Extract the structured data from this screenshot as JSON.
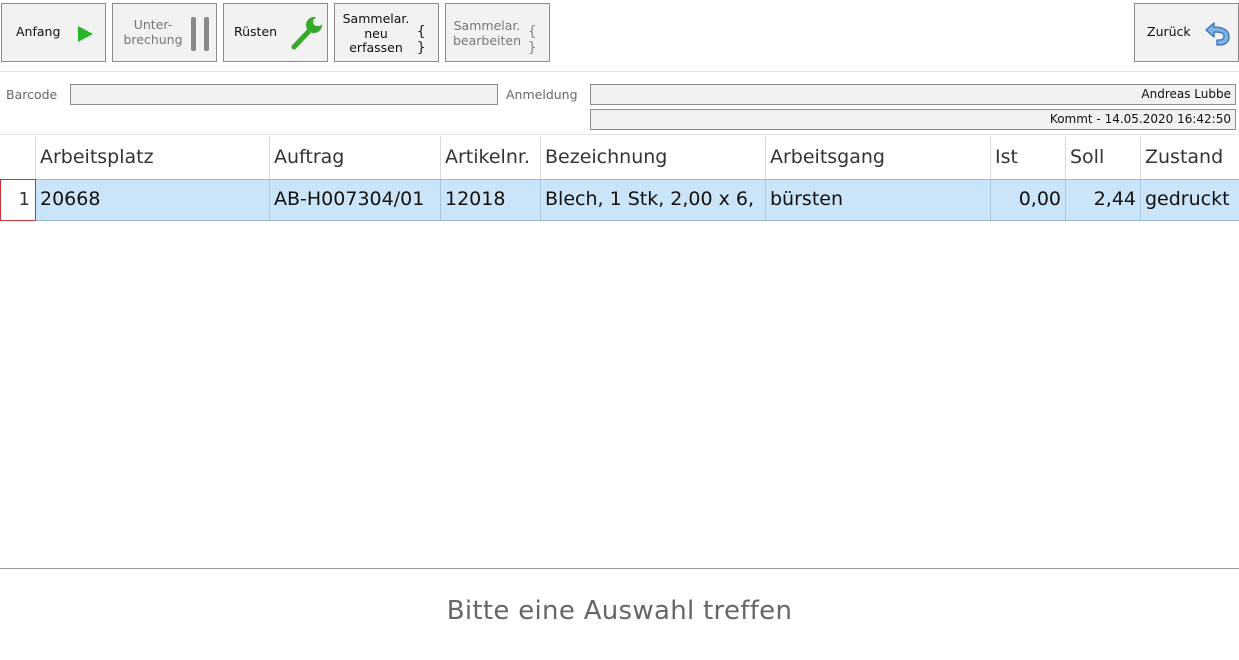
{
  "toolbar": {
    "anfang": "Anfang",
    "unterbrechung_line1": "Unter-",
    "unterbrechung_line2": "brechung",
    "ruesten": "Rüsten",
    "sammelar_neu_line1": "Sammelar.",
    "sammelar_neu_line2": "neu",
    "sammelar_neu_line3": "erfassen",
    "sammelar_bearb_line1": "Sammelar.",
    "sammelar_bearb_line2": "bearbeiten",
    "braces": "{ }",
    "zurueck": "Zurück",
    "icons": {
      "anfang": "play-icon",
      "unterbrechung": "pause-icon",
      "ruesten": "wrench-icon",
      "sammelar": "braces-icon",
      "zurueck": "return-arrow-icon"
    }
  },
  "info": {
    "barcode_label": "Barcode",
    "barcode_value": "",
    "anmeldung_label": "Anmeldung",
    "user_name": "Andreas Lubbe",
    "kommt": "Kommt - 14.05.2020 16:42:50"
  },
  "table": {
    "headers": [
      "Arbeitsplatz",
      "Auftrag",
      "Artikelnr.",
      "Bezeichnung",
      "Arbeitsgang",
      "Ist",
      "Soll",
      "Zustand"
    ],
    "rows": [
      {
        "index": "1",
        "arbeitsplatz": "20668",
        "auftrag": "AB-H007304/01",
        "artikelnr": "12018",
        "bezeichnung": "Blech, 1 Stk, 2,00 x 6,",
        "arbeitsgang": "bürsten",
        "ist": "0,00",
        "soll": "2,44",
        "zustand": "gedruckt"
      }
    ]
  },
  "status": "Bitte eine Auswahl treffen",
  "colors": {
    "selected_row": "#cce4f7",
    "play_green": "#2ab42a",
    "wrench_green": "#36a82a",
    "row_indicator_border": "#c8343a"
  }
}
